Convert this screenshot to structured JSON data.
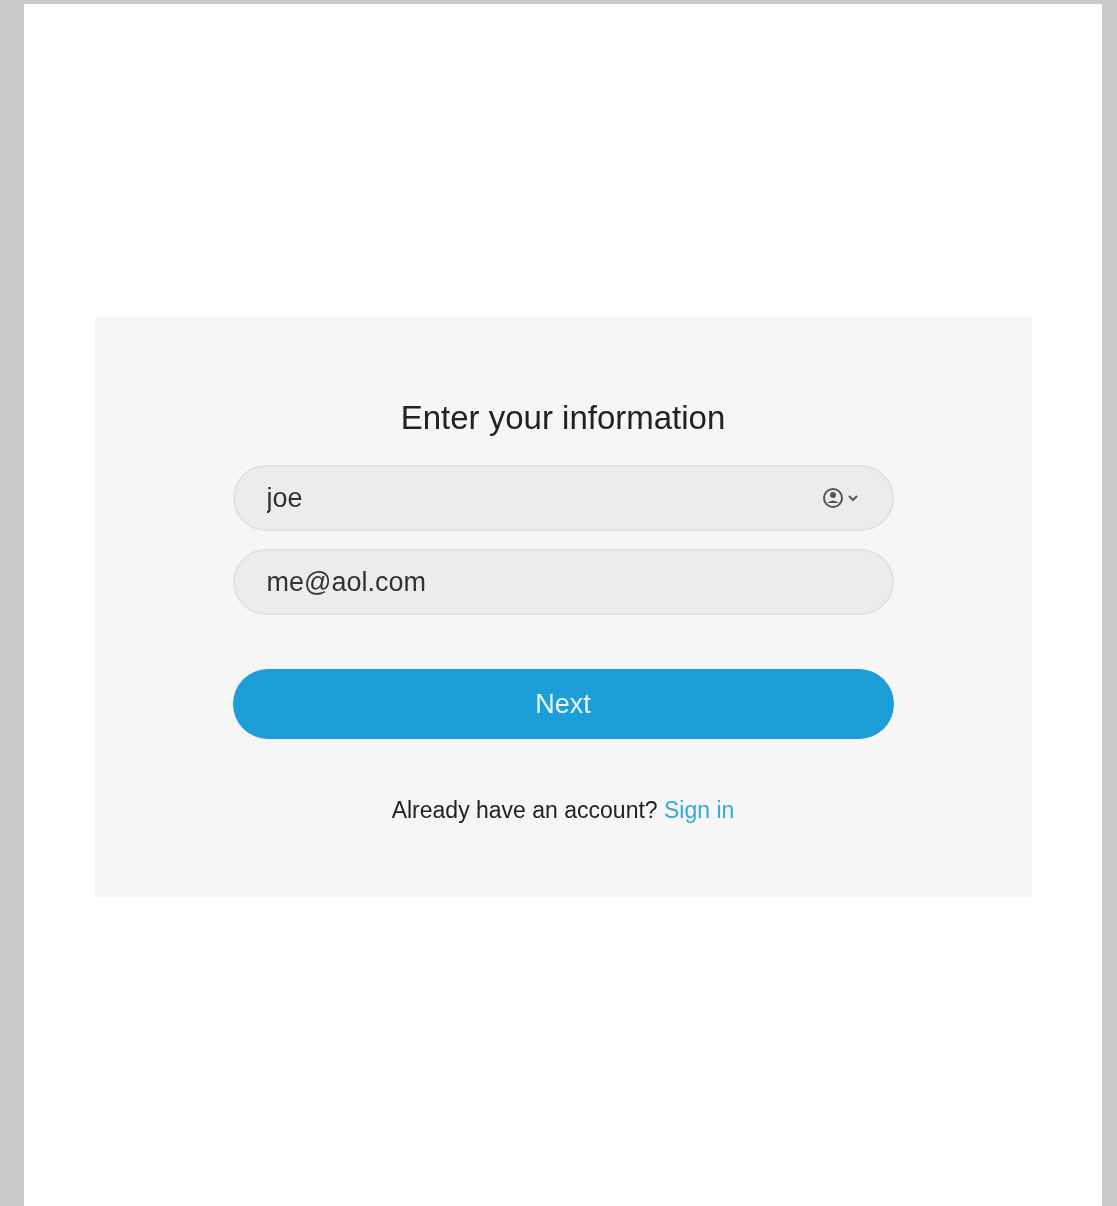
{
  "form": {
    "title": "Enter your information",
    "fields": [
      {
        "kind": "name",
        "value": "joe"
      },
      {
        "kind": "email",
        "value": "me@aol.com"
      }
    ],
    "button": "Next",
    "footer": {
      "text": "Already have an account?",
      "link": "Sign in"
    }
  }
}
